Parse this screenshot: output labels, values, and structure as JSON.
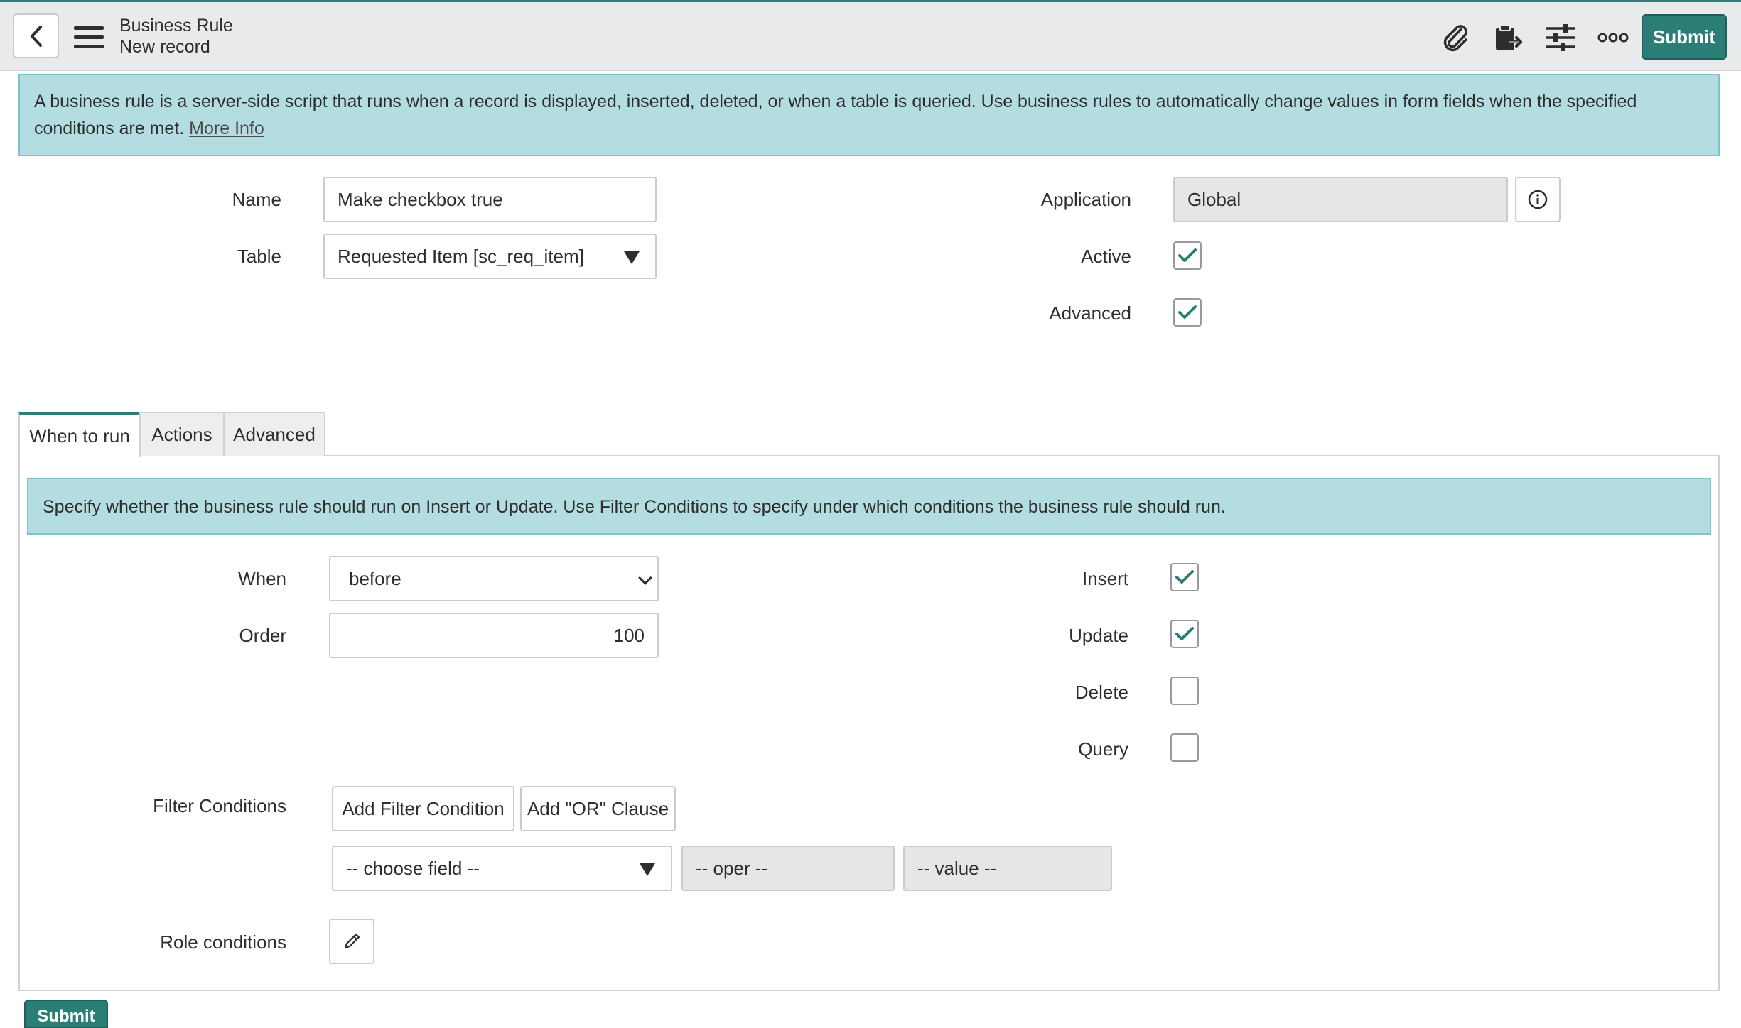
{
  "header": {
    "title": "Business Rule",
    "subtitle": "New record",
    "submit_label": "Submit",
    "icons": [
      "back-icon",
      "hamburger-menu-icon",
      "paperclip-icon",
      "clipboard-icon",
      "sliders-icon",
      "more-icon"
    ]
  },
  "banner": {
    "text": "A business rule is a server-side script that runs when a record is displayed, inserted, deleted, or when a table is queried. Use business rules to automatically change values in form fields when the specified conditions are met.",
    "link": "More Info"
  },
  "form": {
    "name_label": "Name",
    "name_value": "Make checkbox true",
    "table_label": "Table",
    "table_value": "Requested Item [sc_req_item]",
    "application_label": "Application",
    "application_value": "Global",
    "active_label": "Active",
    "active_checked": true,
    "advanced_label": "Advanced",
    "advanced_checked": true
  },
  "tabs": [
    {
      "label": "When to run",
      "active": true
    },
    {
      "label": "Actions",
      "active": false
    },
    {
      "label": "Advanced",
      "active": false
    }
  ],
  "when_to_run": {
    "info": "Specify whether the business rule should run on Insert or Update. Use Filter Conditions to specify under which conditions the business rule should run.",
    "when_label": "When",
    "when_value": "before",
    "order_label": "Order",
    "order_value": "100",
    "insert_label": "Insert",
    "insert_checked": true,
    "update_label": "Update",
    "update_checked": true,
    "delete_label": "Delete",
    "delete_checked": false,
    "query_label": "Query",
    "query_checked": false,
    "filter_label": "Filter Conditions",
    "add_filter_label": "Add Filter Condition",
    "add_or_label": "Add \"OR\" Clause",
    "choose_field": "-- choose field --",
    "oper": "-- oper --",
    "value": "-- value --",
    "role_label": "Role conditions"
  },
  "footer": {
    "submit_label": "Submit"
  },
  "colors": {
    "accent": "#2a7e76",
    "banner": "#b4dde2",
    "header_bg": "#e9eaeb"
  }
}
